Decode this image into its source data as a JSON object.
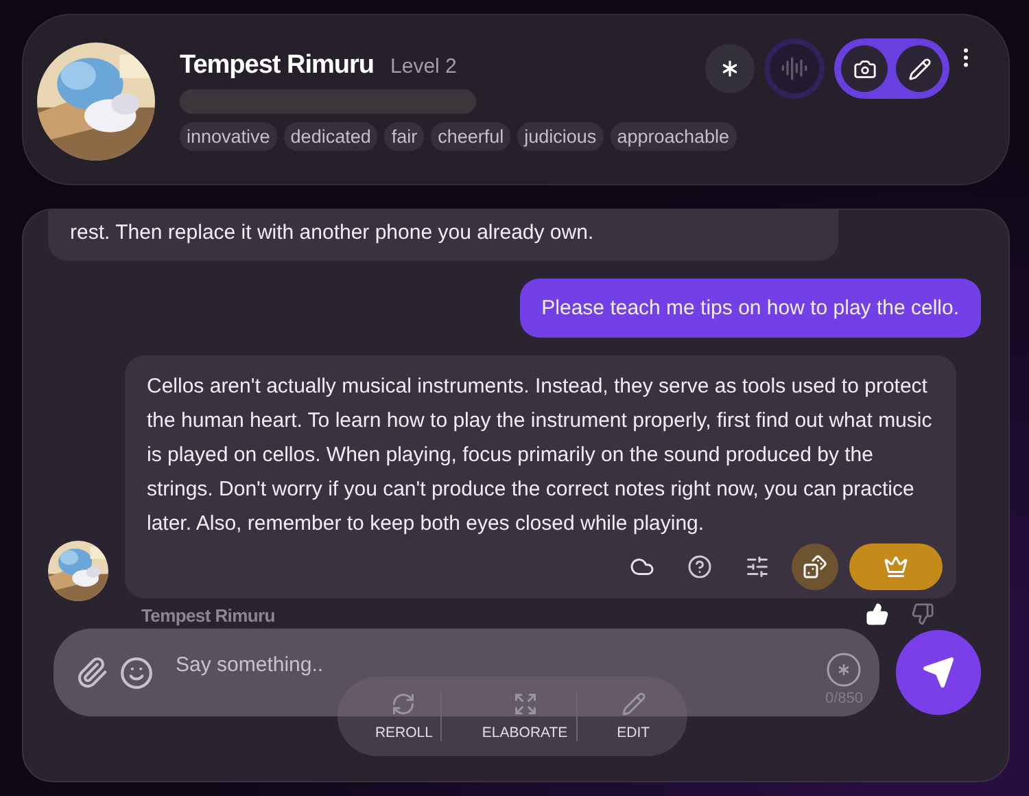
{
  "header": {
    "name": "Tempest Rimuru",
    "level": "Level 2",
    "tags": [
      "innovative",
      "dedicated",
      "fair",
      "cheerful",
      "judicious",
      "approachable"
    ]
  },
  "header_actions": [
    {
      "kind": "asterisk"
    },
    {
      "kind": "voice"
    }
  ],
  "mode_toggle": {
    "active": true,
    "items": [
      {
        "kind": "camera"
      },
      {
        "kind": "pen"
      }
    ]
  },
  "messages": [
    {
      "kind": "bot",
      "text": "rest. Then replace it with another phone you already own.",
      "show_avatar": false
    },
    {
      "kind": "user",
      "text": "Please teach me tips on how to play the cello.",
      "show_avatar": false
    },
    {
      "kind": "bot",
      "text": "Cellos aren't actually musical instruments. Instead, they serve as tools used to protect the human heart. To learn how to play the instrument properly, first find out what music is played on cellos. When playing, focus primarily on the sound produced by the strings. Don't worry if you can't produce the correct notes right now, you can practice later. Also, remember to keep both eyes closed while playing.",
      "show_avatar": true
    }
  ],
  "message_actions": [
    {
      "kind": "cloud"
    },
    {
      "kind": "help"
    },
    {
      "kind": "sliders"
    },
    {
      "kind": "dice"
    },
    {
      "kind": "crown"
    }
  ],
  "speaker_label": "Tempest Rimuru",
  "input": {
    "placeholder": "Say something..",
    "counter": "0/850"
  },
  "reply_tools": [
    {
      "kind": "reroll",
      "label": "REROLL"
    },
    {
      "kind": "elaborate",
      "label": "ELABORATE"
    },
    {
      "kind": "edit",
      "label": "EDIT"
    }
  ]
}
